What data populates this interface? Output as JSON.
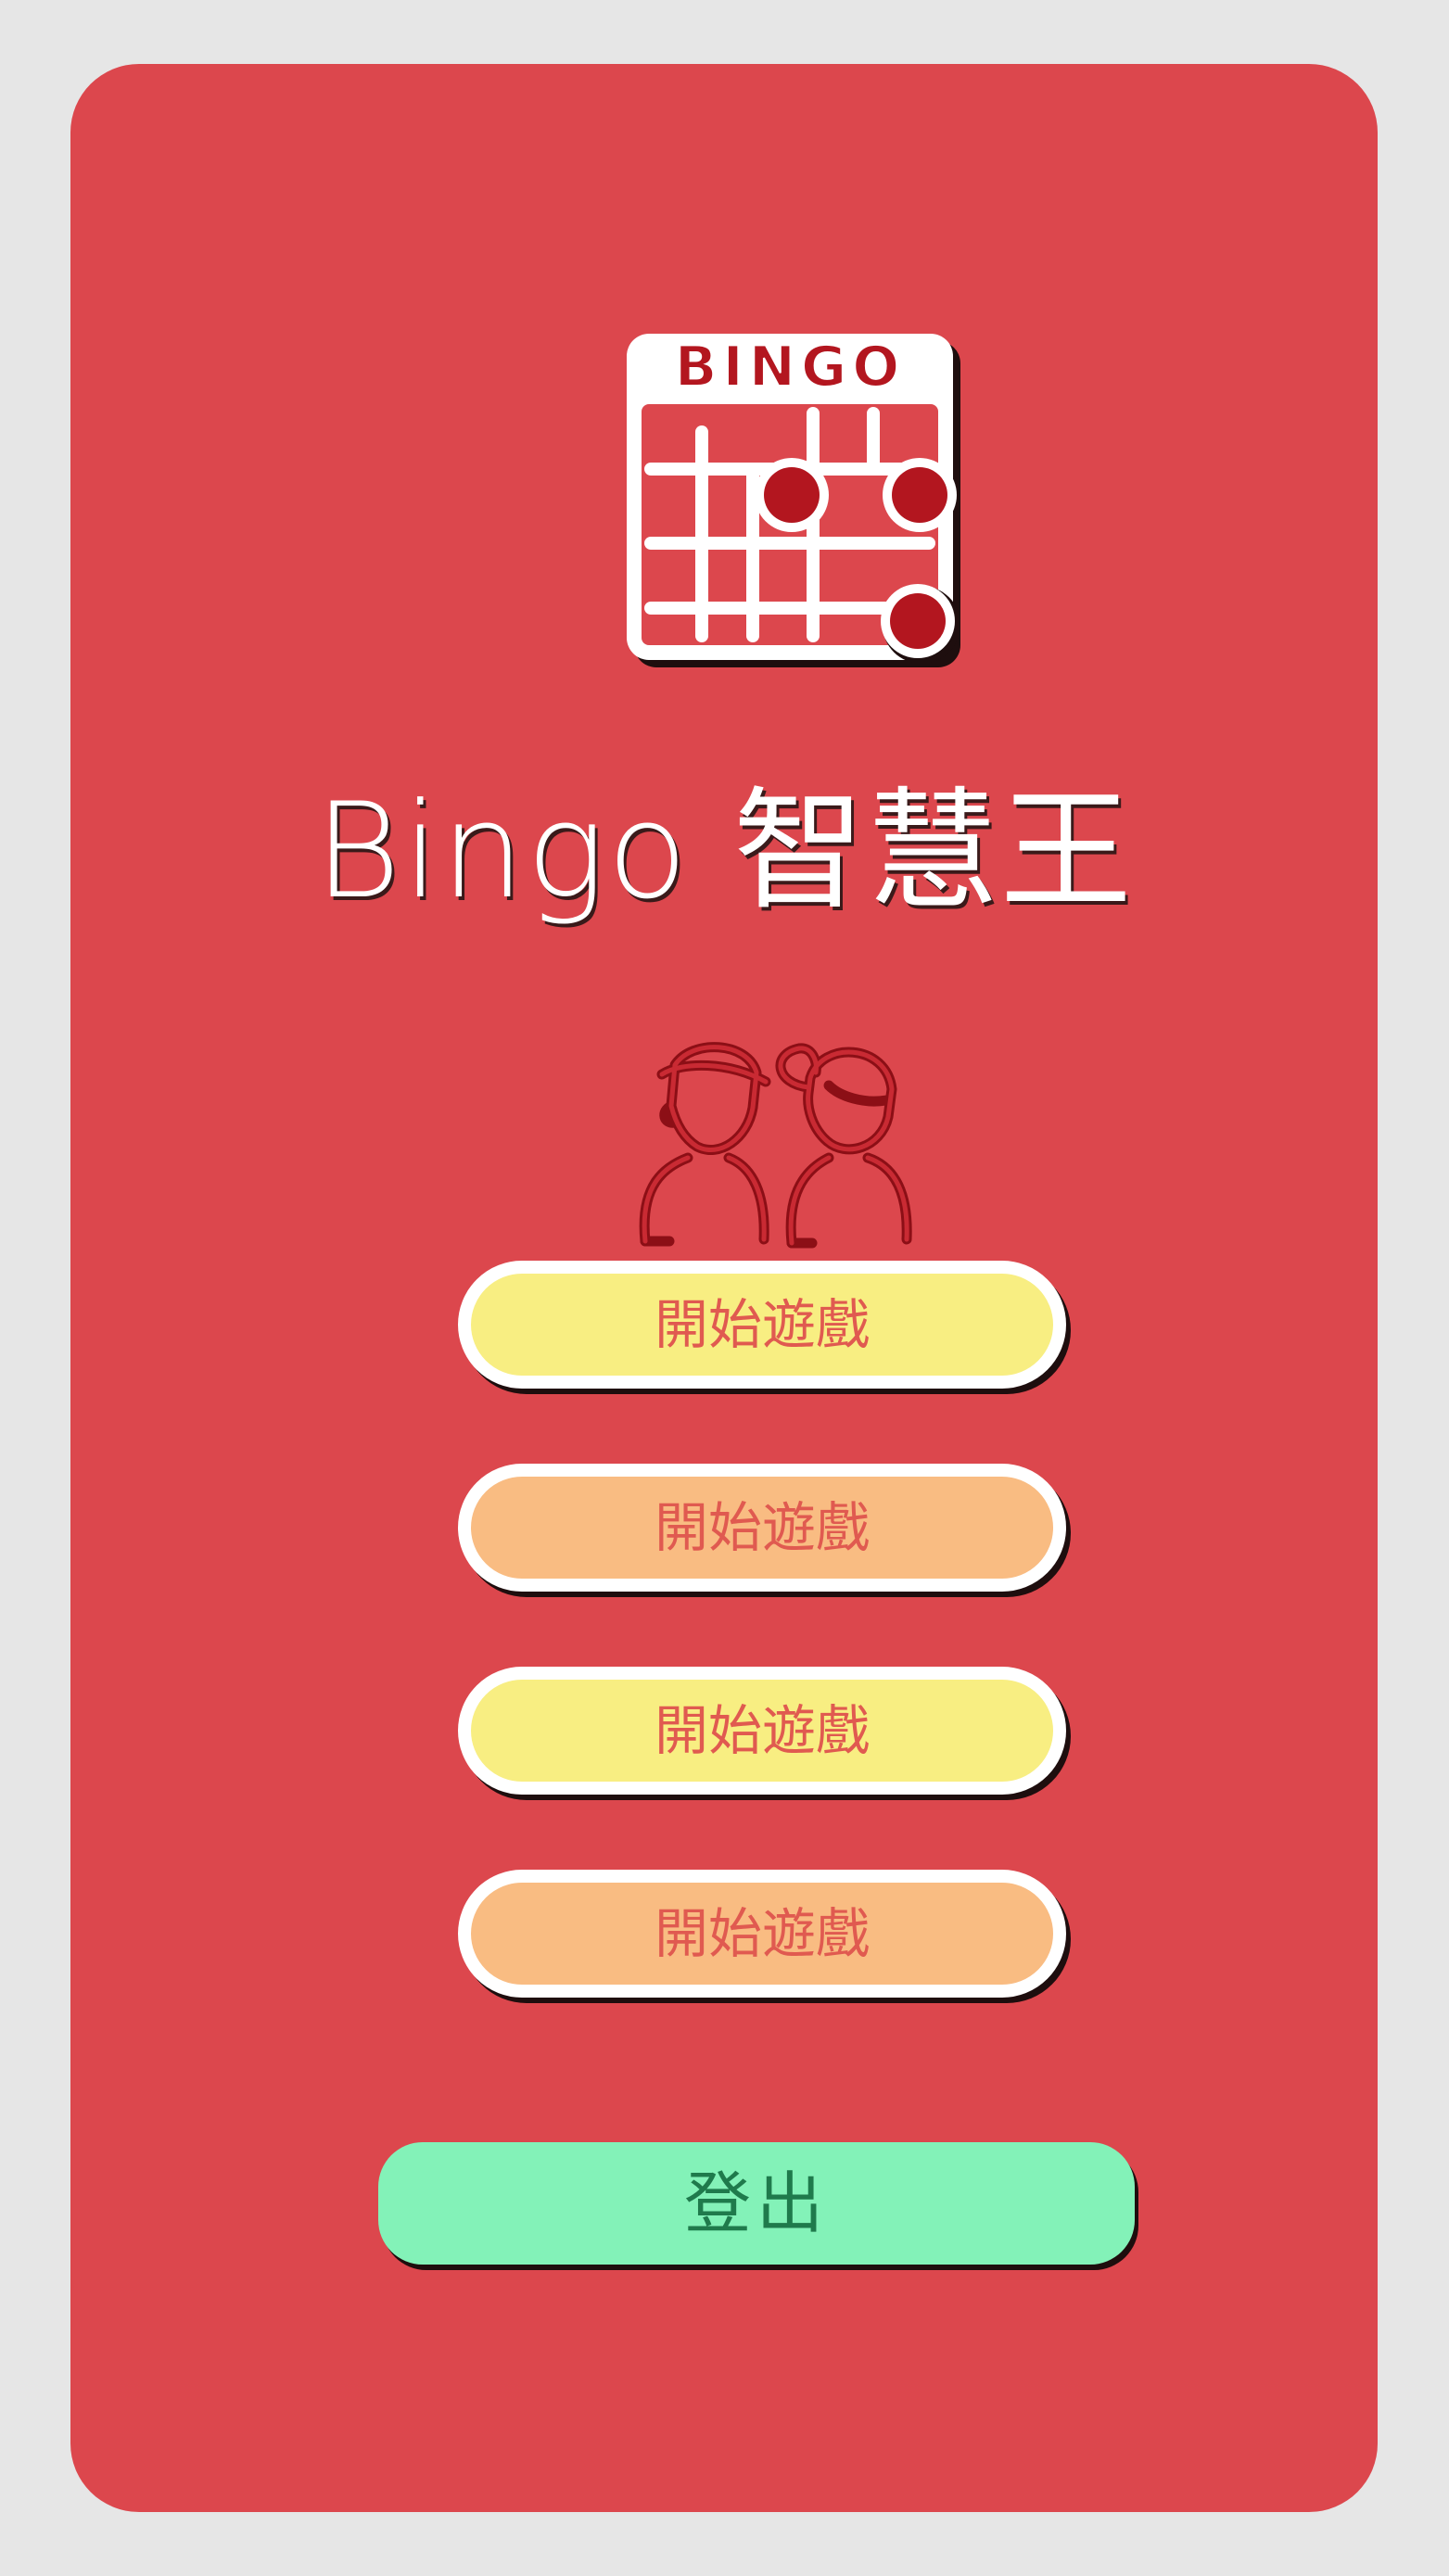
{
  "logo": {
    "text": "BINGO",
    "icon": "bingo-card-icon"
  },
  "title": "Bingo 智慧王",
  "illustration": {
    "icon": "boy-girl-icon"
  },
  "menu": {
    "buttons": [
      {
        "label": "開始遊戲",
        "color": "#f8ee82"
      },
      {
        "label": "開始遊戲",
        "color": "#f9bc82"
      },
      {
        "label": "開始遊戲",
        "color": "#f8ee82"
      },
      {
        "label": "開始遊戲",
        "color": "#f9bc82"
      }
    ]
  },
  "logout": {
    "label": "登出",
    "color": "#83f2b8"
  },
  "colors": {
    "background": "#e6e6e6",
    "card": "#dc474d",
    "accent_dark": "#b3161f",
    "text_on_buttons": "#e05a50"
  }
}
